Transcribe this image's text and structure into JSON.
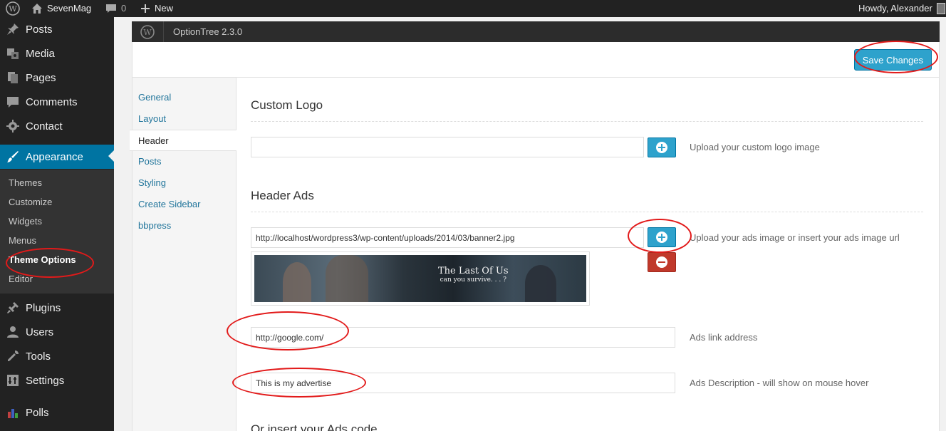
{
  "adminbar": {
    "site_name": "SevenMag",
    "comments_count": "0",
    "new_label": "New",
    "greeting": "Howdy, Alexander"
  },
  "sidebar": {
    "items": [
      {
        "label": "Posts",
        "icon": "pin-icon"
      },
      {
        "label": "Media",
        "icon": "media-icon"
      },
      {
        "label": "Pages",
        "icon": "pages-icon"
      },
      {
        "label": "Comments",
        "icon": "comments-icon"
      },
      {
        "label": "Contact",
        "icon": "gear-icon"
      },
      {
        "label": "Appearance",
        "icon": "brush-icon"
      },
      {
        "label": "Plugins",
        "icon": "plug-icon"
      },
      {
        "label": "Users",
        "icon": "user-icon"
      },
      {
        "label": "Tools",
        "icon": "wrench-icon"
      },
      {
        "label": "Settings",
        "icon": "settings-icon"
      },
      {
        "label": "Polls",
        "icon": "bar-chart-icon"
      }
    ],
    "submenu": [
      "Themes",
      "Customize",
      "Widgets",
      "Menus",
      "Theme Options",
      "Editor"
    ]
  },
  "optiontree": {
    "title": "OptionTree 2.3.0",
    "save_label": "Save Changes",
    "tabs": [
      "General",
      "Layout",
      "Header",
      "Posts",
      "Styling",
      "Create Sidebar",
      "bbpress"
    ],
    "active_tab": "Header"
  },
  "content": {
    "custom_logo_title": "Custom Logo",
    "custom_logo_value": "",
    "custom_logo_desc": "Upload your custom logo image",
    "header_ads_title": "Header Ads",
    "ads_image_url": "http://localhost/wordpress3/wp-content/uploads/2014/03/banner2.jpg",
    "ads_image_desc": "Upload your ads image or insert your ads image url",
    "banner_title": "The Last Of Us",
    "banner_subtitle": "can you survive. . . ?",
    "ads_link_value": "http://google.com/",
    "ads_link_desc": "Ads link address",
    "ads_desc_value": "This is my advertise",
    "ads_desc_desc": "Ads Description - will show on mouse hover",
    "ads_code_title": "Or insert your Ads code"
  },
  "colors": {
    "accent": "#0074a2",
    "button": "#2ea2cc",
    "remove": "#c0392b",
    "annotation": "#e21a1a"
  }
}
